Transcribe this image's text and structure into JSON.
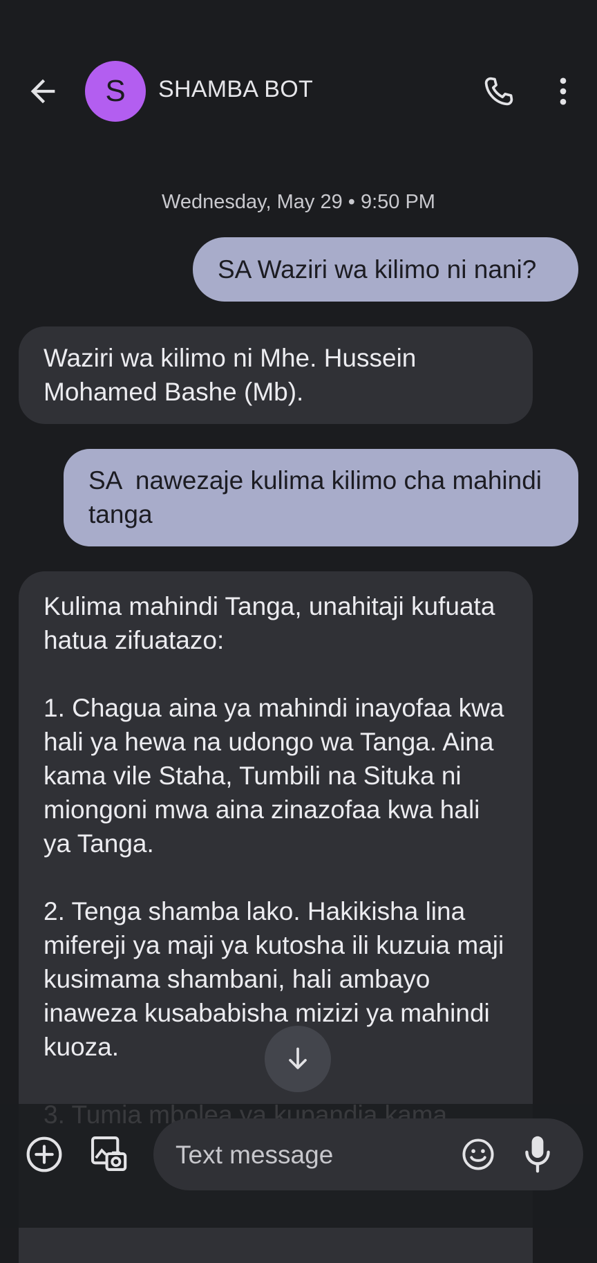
{
  "header": {
    "avatar_letter": "S",
    "avatar_color": "#b35ef0",
    "contact_name": "SHAMBA BOT",
    "icons": [
      "arrow-back-icon",
      "phone-icon",
      "more-vert-icon"
    ]
  },
  "conversation": {
    "date_stamp": "Wednesday, May 29 • 9:50 PM",
    "messages": [
      {
        "direction": "outgoing",
        "text": "SA Waziri wa kilimo ni nani?"
      },
      {
        "direction": "incoming",
        "text": "Waziri wa kilimo ni Mhe. Hussein Mohamed Bashe (Mb)."
      },
      {
        "direction": "outgoing",
        "text": "SA  nawezaje kulima kilimo cha mahindi tanga"
      },
      {
        "direction": "incoming",
        "text": "Kulima mahindi Tanga, unahitaji kufuata hatua zifuatazo:\n\n1. Chagua aina ya mahindi inayofaa kwa hali ya hewa na udongo wa Tanga. Aina kama vile Staha, Tumbili na Situka ni miongoni mwa aina zinazofaa kwa hali ya Tanga.\n\n2. Tenga shamba lako. Hakikisha lina mifereji ya maji ya kutosha ili kuzuia maji kusimama shambani, hali ambayo inaweza kusababisha mizizi ya mahindi kuoza.\n\n3. Tumia mbolea ya kupandia kama"
      }
    ]
  },
  "composer": {
    "placeholder": "Text message",
    "icons": [
      "add-circle-icon",
      "gallery-camera-icon",
      "emoji-icon",
      "mic-icon",
      "arrow-down-icon"
    ]
  },
  "colors": {
    "background": "#1b1c1f",
    "outgoing_bubble": "#a8acca",
    "incoming_bubble": "#303136",
    "accent": "#b35ef0"
  }
}
